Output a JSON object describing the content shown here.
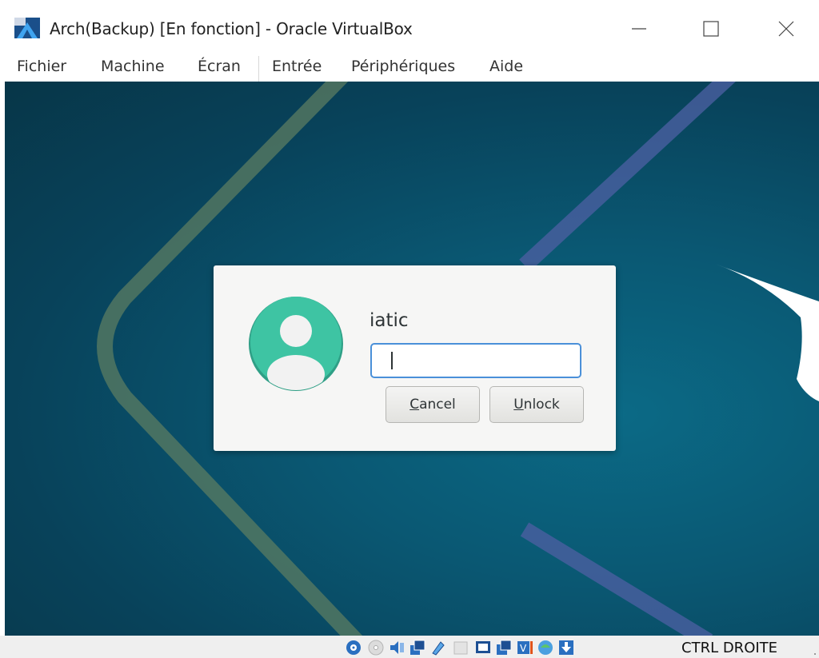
{
  "window": {
    "title": "Arch(Backup) [En fonction] - Oracle VirtualBox"
  },
  "menubar": {
    "items": [
      {
        "label": "Fichier"
      },
      {
        "label": "Machine"
      },
      {
        "label": "Écran"
      },
      {
        "label": "Entrée"
      },
      {
        "label": "Périphériques"
      },
      {
        "label": "Aide"
      }
    ]
  },
  "lock_dialog": {
    "username": "iatic",
    "password_value": "",
    "cancel_prefix": "C",
    "cancel_rest": "ancel",
    "unlock_prefix": "U",
    "unlock_rest": "nlock",
    "avatar_color": "#3ec4a3"
  },
  "statusbar": {
    "icons": [
      "hard-disk-icon",
      "optical-drive-icon",
      "audio-icon",
      "network-icon",
      "usb-icon",
      "shared-folders-icon",
      "display-icon",
      "video-capture-icon",
      "virtualization-icon",
      "mouse-integration-icon",
      "keyboard-capture-icon"
    ],
    "host_key": "CTRL DROITE"
  },
  "colors": {
    "desktop_bg": "#0a5873",
    "input_focus": "#4a90d9"
  }
}
